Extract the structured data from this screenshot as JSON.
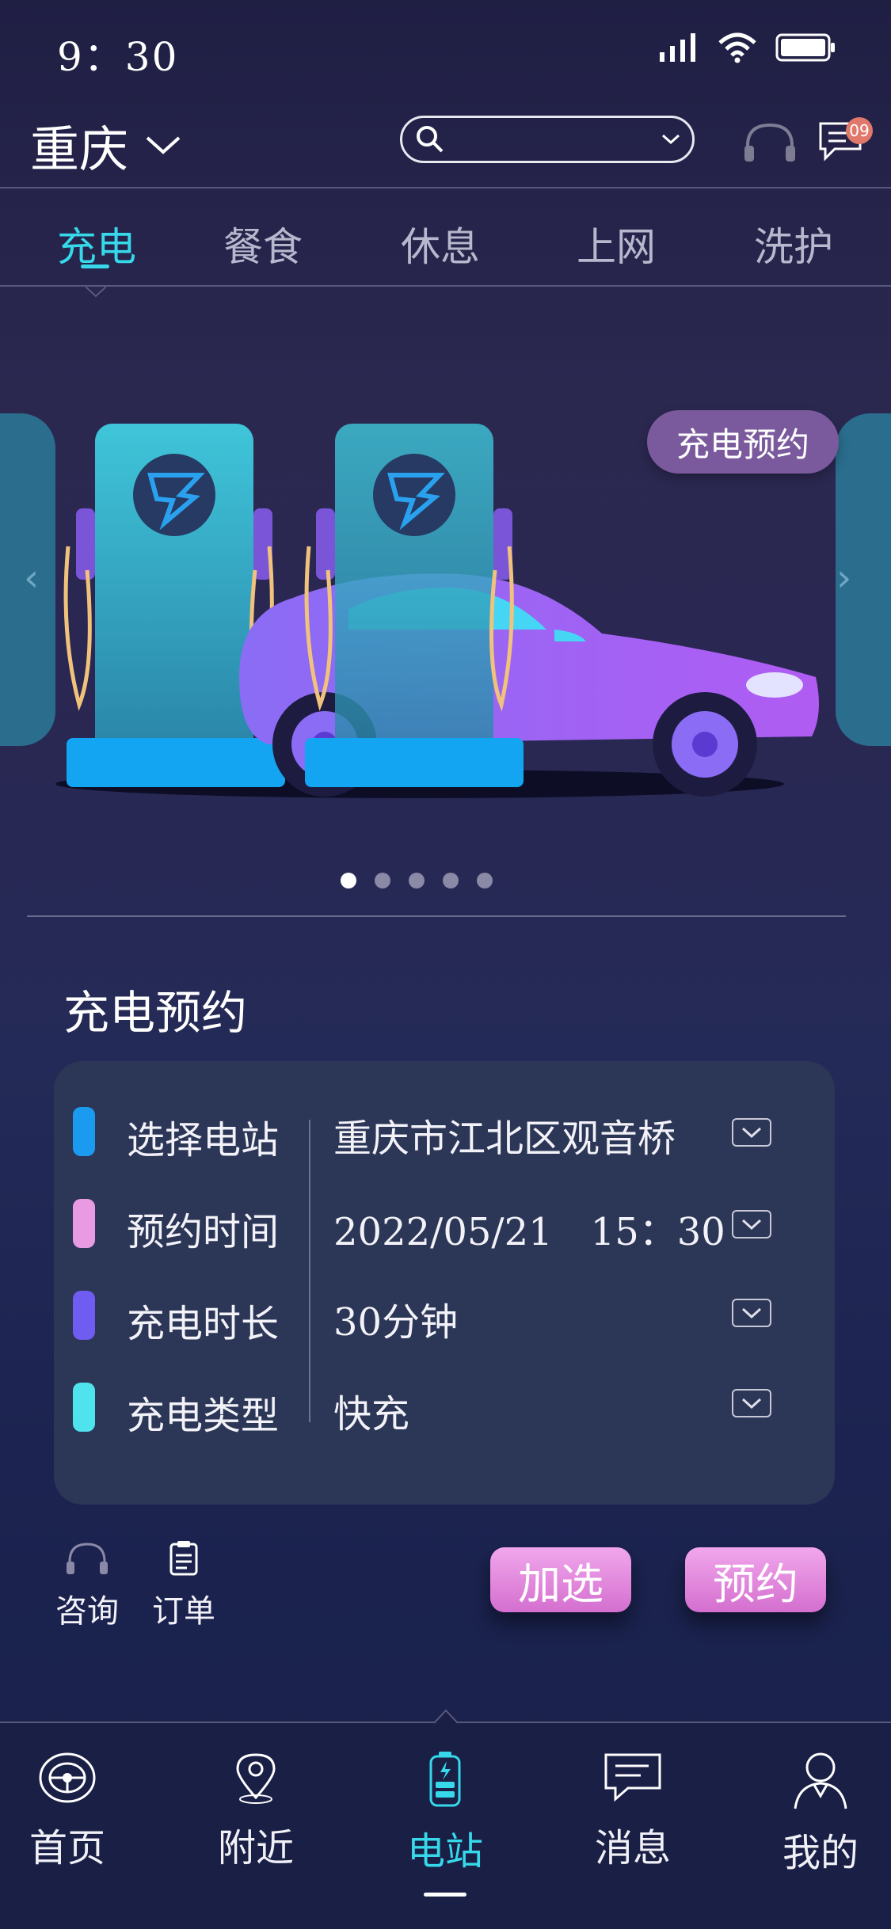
{
  "status": {
    "time": "9：30"
  },
  "header": {
    "city": "重庆",
    "badge": "09"
  },
  "tabs": [
    {
      "label": "充电",
      "active": true
    },
    {
      "label": "餐食",
      "active": false
    },
    {
      "label": "休息",
      "active": false
    },
    {
      "label": "上网",
      "active": false
    },
    {
      "label": "洗护",
      "active": false
    }
  ],
  "banner": {
    "promo_label": "充电预约",
    "slide_index": 1,
    "slide_count": 5,
    "prev_arrow": "‹",
    "next_arrow": "›"
  },
  "booking": {
    "title": "充电预约",
    "rows": [
      {
        "label": "选择电站",
        "value": "重庆市江北区观音桥",
        "color": "#1a9bf0"
      },
      {
        "label": "预约时间",
        "value": "2022/05/21　15：30",
        "color": "#e89be3"
      },
      {
        "label": "充电时长",
        "value": "30分钟",
        "color": "#6f5cf0"
      },
      {
        "label": "充电类型",
        "value": "快充",
        "color": "#4fe3ee"
      }
    ]
  },
  "actions": {
    "consult": "咨询",
    "order": "订单",
    "add_label": "加选",
    "reserve_label": "预约"
  },
  "tabbar": [
    {
      "label": "首页",
      "icon": "steering-wheel-icon"
    },
    {
      "label": "附近",
      "icon": "location-pin-icon"
    },
    {
      "label": "电站",
      "icon": "battery-icon",
      "active": true
    },
    {
      "label": "消息",
      "icon": "message-icon"
    },
    {
      "label": "我的",
      "icon": "user-icon"
    }
  ],
  "colors": {
    "accent": "#36d8ea",
    "button": "#d46fcf"
  }
}
